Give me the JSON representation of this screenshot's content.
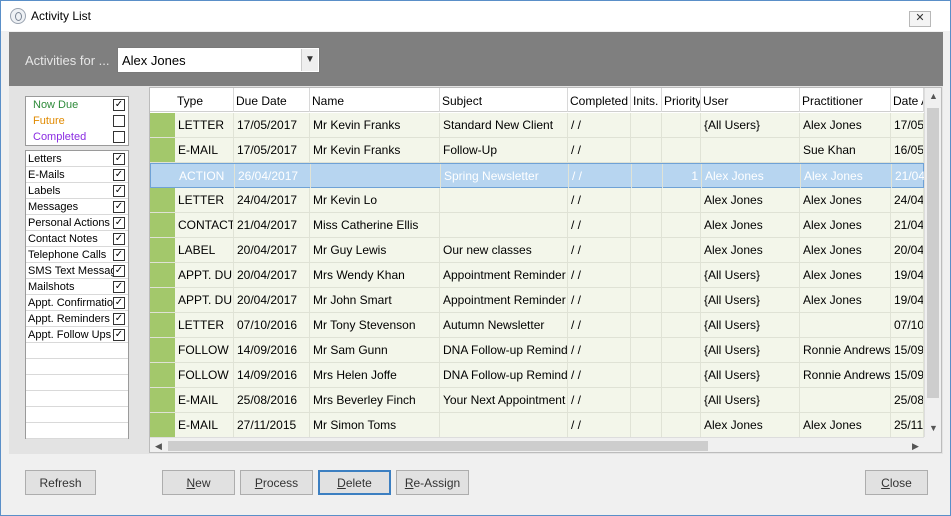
{
  "window": {
    "title": "Activity List",
    "close_glyph": "✕"
  },
  "header": {
    "activities_for_label": "Activities for ...",
    "selected_user": "Alex Jones"
  },
  "status_filters": [
    {
      "label": "Now Due",
      "checked": true,
      "color": "#2e8b3a"
    },
    {
      "label": "Future",
      "checked": false,
      "color": "#e08a00"
    },
    {
      "label": "Completed",
      "checked": false,
      "color": "#8a2be2"
    }
  ],
  "type_filters": [
    {
      "label": "Letters",
      "checked": true
    },
    {
      "label": "E-Mails",
      "checked": true
    },
    {
      "label": "Labels",
      "checked": true
    },
    {
      "label": "Messages",
      "checked": true
    },
    {
      "label": "Personal Actions",
      "checked": true
    },
    {
      "label": "Contact Notes",
      "checked": true
    },
    {
      "label": "Telephone Calls",
      "checked": true
    },
    {
      "label": "SMS Text Messages",
      "checked": true
    },
    {
      "label": "Mailshots",
      "checked": true
    },
    {
      "label": "Appt. Confirmations",
      "checked": true
    },
    {
      "label": "Appt. Reminders",
      "checked": true
    },
    {
      "label": "Appt. Follow Ups",
      "checked": true
    }
  ],
  "grid": {
    "columns": [
      "Type",
      "Due Date",
      "Name",
      "Subject",
      "Completed",
      "Inits.",
      "Priority",
      "User",
      "Practitioner",
      "Date A"
    ],
    "rows": [
      {
        "type": "LETTER",
        "due": "17/05/2017",
        "name": "Mr Kevin Franks",
        "subject": "Standard New Client",
        "completed": "/ /",
        "inits": "",
        "priority": "",
        "user": "{All Users}",
        "practitioner": "Alex Jones",
        "date_a": "17/05",
        "selected": false
      },
      {
        "type": "E-MAIL",
        "due": "17/05/2017",
        "name": "Mr Kevin Franks",
        "subject": "Follow-Up",
        "completed": "/ /",
        "inits": "",
        "priority": "",
        "user": "",
        "practitioner": "Sue Khan",
        "date_a": "16/05",
        "selected": false
      },
      {
        "type": "ACTION",
        "due": "26/04/2017",
        "name": "",
        "subject": "Spring Newsletter",
        "completed": "/ /",
        "inits": "",
        "priority": "1",
        "user": "Alex Jones",
        "practitioner": "Alex Jones",
        "date_a": "21/04",
        "selected": true
      },
      {
        "type": "LETTER",
        "due": "24/04/2017",
        "name": "Mr Kevin Lo",
        "subject": "",
        "completed": "/ /",
        "inits": "",
        "priority": "",
        "user": "Alex Jones",
        "practitioner": "Alex Jones",
        "date_a": "24/04",
        "selected": false
      },
      {
        "type": "CONTACT",
        "due": "21/04/2017",
        "name": "Miss Catherine Ellis",
        "subject": "",
        "completed": "/ /",
        "inits": "",
        "priority": "",
        "user": "Alex Jones",
        "practitioner": "Alex Jones",
        "date_a": "21/04",
        "selected": false
      },
      {
        "type": "LABEL",
        "due": "20/04/2017",
        "name": "Mr Guy Lewis",
        "subject": "Our new classes",
        "completed": "/ /",
        "inits": "",
        "priority": "",
        "user": "Alex Jones",
        "practitioner": "Alex Jones",
        "date_a": "20/04",
        "selected": false
      },
      {
        "type": "APPT. DU",
        "due": "20/04/2017",
        "name": "Mrs Wendy Khan",
        "subject": "Appointment Reminder",
        "completed": "/ /",
        "inits": "",
        "priority": "",
        "user": "{All Users}",
        "practitioner": "Alex Jones",
        "date_a": "19/04",
        "selected": false
      },
      {
        "type": "APPT. DU",
        "due": "20/04/2017",
        "name": "Mr John Smart",
        "subject": "Appointment Reminder",
        "completed": "/ /",
        "inits": "",
        "priority": "",
        "user": "{All Users}",
        "practitioner": "Alex Jones",
        "date_a": "19/04",
        "selected": false
      },
      {
        "type": "LETTER",
        "due": "07/10/2016",
        "name": "Mr Tony Stevenson",
        "subject": "Autumn Newsletter",
        "completed": "/ /",
        "inits": "",
        "priority": "",
        "user": "{All Users}",
        "practitioner": "",
        "date_a": "07/10",
        "selected": false
      },
      {
        "type": "FOLLOW",
        "due": "14/09/2016",
        "name": "Mr Sam Gunn",
        "subject": "DNA Follow-up Reminder",
        "completed": "/ /",
        "inits": "",
        "priority": "",
        "user": "{All Users}",
        "practitioner": "Ronnie Andrews",
        "date_a": "15/09",
        "selected": false
      },
      {
        "type": "FOLLOW",
        "due": "14/09/2016",
        "name": "Mrs Helen Joffe",
        "subject": "DNA Follow-up Reminder",
        "completed": "/ /",
        "inits": "",
        "priority": "",
        "user": "{All Users}",
        "practitioner": "Ronnie Andrews",
        "date_a": "15/09",
        "selected": false
      },
      {
        "type": "E-MAIL",
        "due": "25/08/2016",
        "name": "Mrs Beverley Finch",
        "subject": "Your Next Appointment",
        "completed": "/ /",
        "inits": "",
        "priority": "",
        "user": "{All Users}",
        "practitioner": "",
        "date_a": "25/08",
        "selected": false
      },
      {
        "type": "E-MAIL",
        "due": "27/11/2015",
        "name": "Mr Simon Toms",
        "subject": "",
        "completed": "/ /",
        "inits": "",
        "priority": "",
        "user": "Alex Jones",
        "practitioner": "Alex Jones",
        "date_a": "25/11",
        "selected": false
      }
    ]
  },
  "buttons": {
    "refresh": "Refresh",
    "new": {
      "first": "N",
      "rest": "ew"
    },
    "process": {
      "first": "P",
      "rest": "rocess"
    },
    "delete": {
      "first": "D",
      "rest": "elete"
    },
    "reassign": {
      "first": "R",
      "rest": "e-Assign"
    },
    "close": {
      "first": "C",
      "rest": "lose"
    }
  },
  "icons": {
    "scroll_up": "▲",
    "scroll_down": "▼",
    "scroll_left": "◀",
    "scroll_right": "▶",
    "dropdown": "▼",
    "check": "✓"
  }
}
